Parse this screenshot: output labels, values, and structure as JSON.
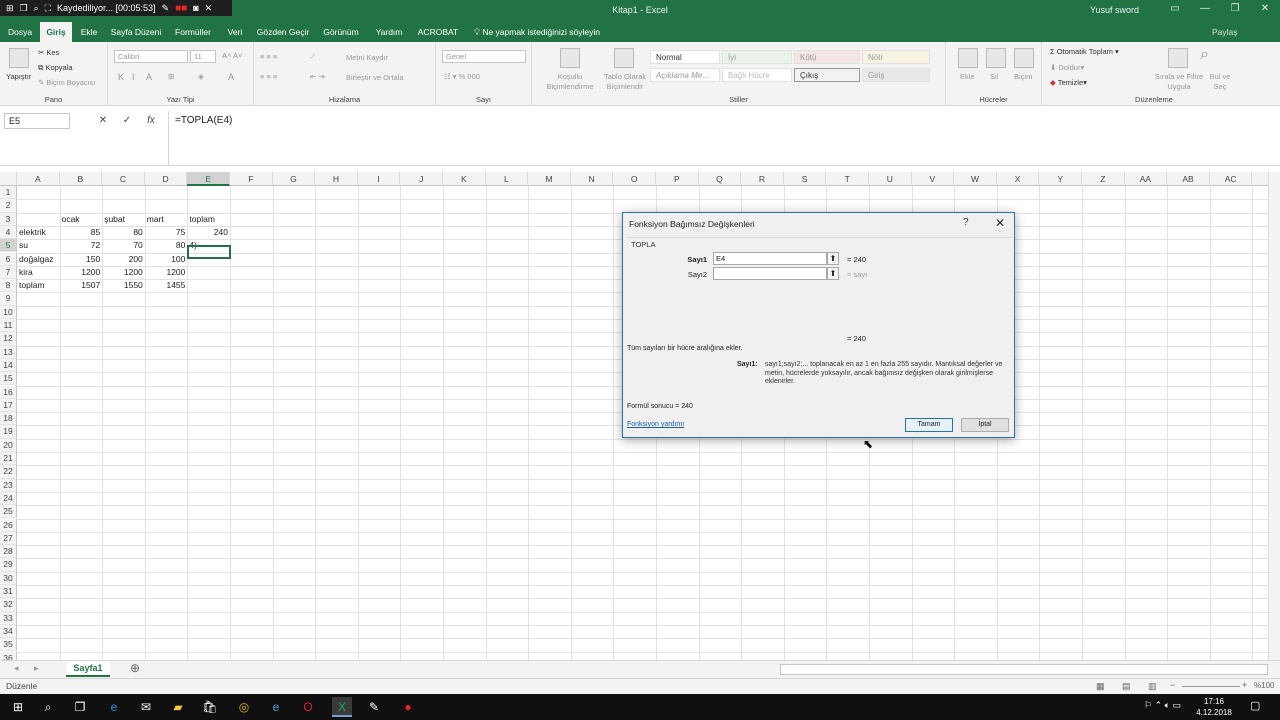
{
  "recorder": {
    "status": "Kaydediliyor... [00:05:53]"
  },
  "window": {
    "title": "Kitap1 - Excel",
    "user": "Yusuf sword"
  },
  "tabs": [
    "Dosya",
    "Giriş",
    "Ekle",
    "Sayfa Düzeni",
    "Formüller",
    "Veri",
    "Gözden Geçir",
    "Görünüm",
    "Yardım",
    "ACROBAT"
  ],
  "active_tab": "Giriş",
  "tell_me": "Ne yapmak istediğinizi söyleyin",
  "share": "Paylaş",
  "ribbon": {
    "clipboard": {
      "paste": "Yapıştır",
      "cut": "Kes",
      "copy": "Kopyala",
      "format_painter": "Biçim Boyacısı",
      "label": "Pano"
    },
    "font": {
      "name": "Calibri",
      "size": "11",
      "label": "Yazı Tipi"
    },
    "alignment": {
      "wrap": "Metni Kaydır",
      "merge": "Birleştir ve Ortala",
      "label": "Hizalama"
    },
    "number": {
      "format": "Genel",
      "label": "Sayı"
    },
    "styles": {
      "conditional": "Koşullu Biçimlendirme",
      "table": "Tablo Olarak Biçimlendir",
      "normal": "Normal",
      "good": "İyi",
      "bad": "Kötü",
      "neutral": "Nötr",
      "explanatory": "Açıklama Me...",
      "linked": "Bağlı Hücre",
      "output": "Çıkış",
      "input": "Giriş",
      "label": "Stiller"
    },
    "cells": {
      "insert": "Ekle",
      "delete": "Sil",
      "format": "Biçim",
      "label": "Hücreler"
    },
    "editing": {
      "autosum": "Otomatik Toplam",
      "fill": "Doldur",
      "clear": "Temizle",
      "sort": "Sırala ve Filtre Uygula",
      "find": "Bul ve Seç",
      "label": "Düzenleme"
    }
  },
  "formula_bar": {
    "name_box": "E5",
    "formula": "=TOPLA(E4)"
  },
  "columns": [
    "A",
    "B",
    "C",
    "D",
    "E",
    "F",
    "G",
    "H",
    "I",
    "J",
    "K",
    "L",
    "M",
    "N",
    "O",
    "P",
    "Q",
    "R",
    "S",
    "T",
    "U",
    "V",
    "W",
    "X",
    "Y",
    "Z",
    "AA",
    "AB",
    "AC"
  ],
  "rows": [
    "1",
    "2",
    "3",
    "4",
    "5",
    "6",
    "7",
    "8",
    "9",
    "10",
    "11",
    "12",
    "13",
    "14",
    "15",
    "16",
    "17",
    "18",
    "19",
    "20",
    "21",
    "22",
    "23",
    "24",
    "25",
    "26",
    "27",
    "28",
    "29",
    "30",
    "31",
    "32",
    "33",
    "34",
    "35",
    "36"
  ],
  "cells": {
    "headers": [
      "ocak",
      "şubat",
      "mart",
      "toplam"
    ],
    "table": [
      {
        "label": "elektrik",
        "b": "85",
        "c": "80",
        "d": "75",
        "e": "240"
      },
      {
        "label": "su",
        "b": "72",
        "c": "70",
        "d": "80",
        "e": "4)"
      },
      {
        "label": "doğalgaz",
        "b": "150",
        "c": "200",
        "d": "100",
        "e": ""
      },
      {
        "label": "kira",
        "b": "1200",
        "c": "1200",
        "d": "1200",
        "e": ""
      },
      {
        "label": "toplam",
        "b": "1507",
        "c": "1550",
        "d": "1455",
        "e": ""
      }
    ]
  },
  "dialog": {
    "title": "Fonksiyon Bağımsız Değişkenleri",
    "help": "?",
    "function": "TOPLA",
    "arg1_label": "Sayı1",
    "arg1_value": "E4",
    "arg1_result": "= 240",
    "arg2_label": "Sayı2",
    "arg2_value": "",
    "arg2_result": "= sayı",
    "total": "= 240",
    "description": "Tüm sayıları bir hücre aralığına ekler.",
    "arg_name": "Sayı1:",
    "arg_description": "sayı1;sayı2;... toplanacak en az 1 en fazla 255 sayıdır. Mantıksal değerler ve metin, hücrelerde yoksayılır, ancak bağımsız değişken olarak girilmişlerse eklenirler.",
    "formula_result": "Formül sonucu =   240",
    "help_link": "Fonksiyon yardımı",
    "ok": "Tamam",
    "cancel": "İptal"
  },
  "sheet_tab": "Sayfa1",
  "status": "Düzenle",
  "zoom": "%100",
  "clock": {
    "time": "17:16",
    "date": "4.12.2018"
  },
  "taskbar": [
    "windows-icon",
    "search-icon",
    "task-view-icon",
    "edge-icon",
    "mail-icon",
    "file-explorer-icon",
    "store-icon",
    "chrome-icon",
    "ie-icon",
    "opera-icon",
    "excel-icon",
    "paint-icon",
    "recorder-icon"
  ]
}
